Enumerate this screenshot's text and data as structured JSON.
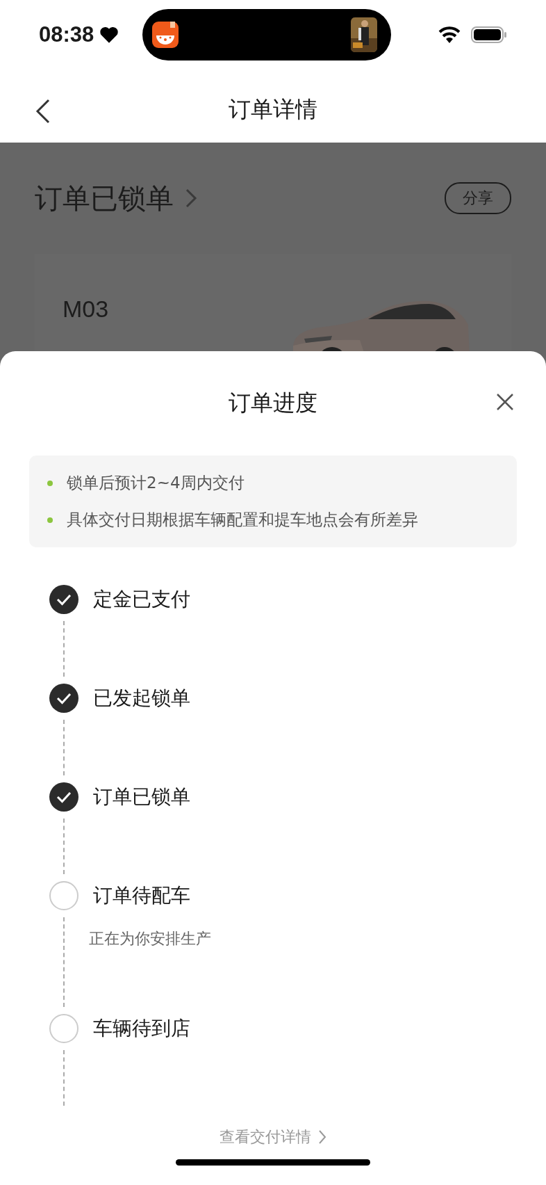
{
  "status_bar": {
    "time": "08:38"
  },
  "nav": {
    "title": "订单详情"
  },
  "order": {
    "status": "订单已锁单",
    "share": "分享",
    "model": "M03"
  },
  "sheet": {
    "title": "订单进度",
    "notes": [
      "锁单后预计2~4周内交付",
      "具体交付日期根据车辆配置和提车地点会有所差异"
    ],
    "steps": [
      {
        "label": "定金已支付",
        "done": true
      },
      {
        "label": "已发起锁单",
        "done": true
      },
      {
        "label": "订单已锁单",
        "done": true
      },
      {
        "label": "订单待配车",
        "done": false,
        "note": "正在为你安排生产"
      },
      {
        "label": "车辆待到店",
        "done": false
      }
    ],
    "link": "查看交付详情"
  }
}
